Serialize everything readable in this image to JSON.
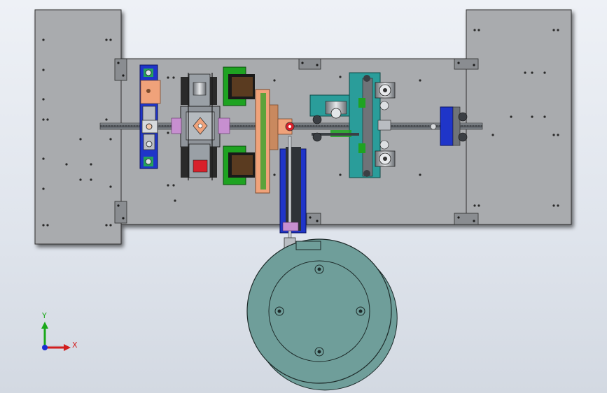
{
  "colors": {
    "background": "#e4e8ef",
    "plate": "#a9abae",
    "plate_edge": "#3a3a3a",
    "rail": "#6f7378",
    "blue_block": "#1f35c9",
    "green_block": "#1ea321",
    "teal_block": "#2a9d9a",
    "salmon_part": "#f0a27a",
    "feeder_bowl": "#6f9e9a",
    "red_part": "#d8202a"
  },
  "icons": {
    "triad": "xyz-axis-triad-icon",
    "feeder": "vibratory-bowl-feeder",
    "mounting_hole": "hole-icon"
  },
  "triad": {
    "x_label": "X",
    "y_label": "Y",
    "x_color": "#d21e1e",
    "y_color": "#1aa81a",
    "z_color": "#1a2fd2"
  }
}
